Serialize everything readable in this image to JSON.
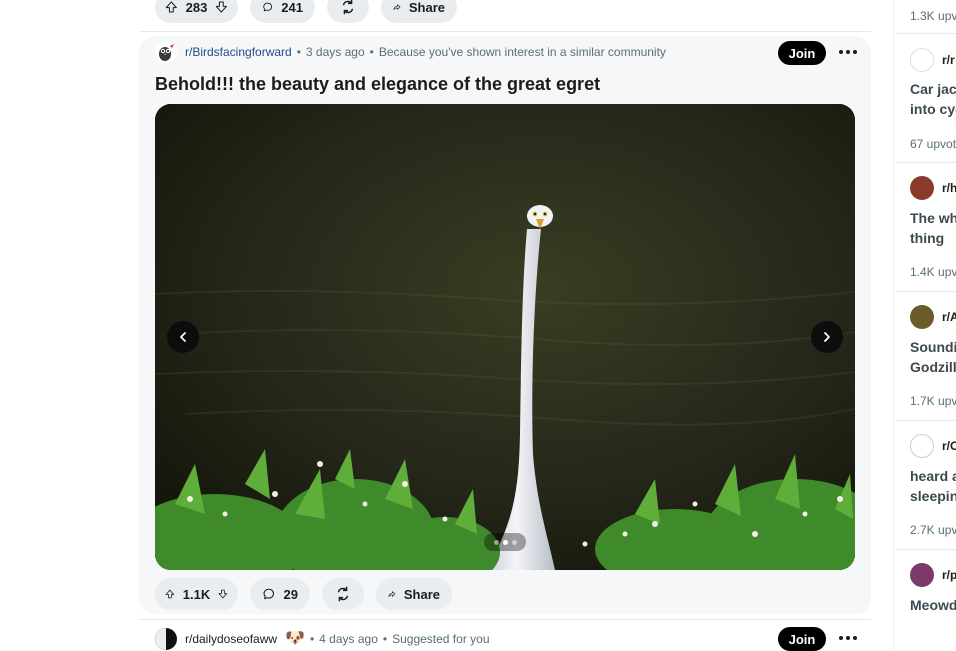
{
  "prev_post": {
    "upvotes": "283",
    "comments": "241",
    "share_label": "Share"
  },
  "post": {
    "subreddit": "r/Birdsfacingforward",
    "time": "3 days ago",
    "reason": "Because you've shown interest in a similar community",
    "join_label": "Join",
    "title": "Behold!!! the beauty and elegance of the great egret",
    "gallery": {
      "current": 2,
      "total": 3
    },
    "upvotes": "1.1K",
    "comments": "29",
    "share_label": "Share"
  },
  "next_post": {
    "subreddit": "r/dailydoseofaww",
    "time": "4 days ago",
    "reason": "Suggested for you",
    "join_label": "Join"
  },
  "sidebar": {
    "top_stat": "1.3K upv",
    "items": [
      {
        "sub": "r/r",
        "title": "Car jack\ninto cyc",
        "stat": "67 upvot"
      },
      {
        "sub": "r/h",
        "title": "The wh\nthing",
        "stat": "1.4K upv"
      },
      {
        "sub": "r/A",
        "title": "Soundi\nGodzill",
        "stat": "1.7K upv"
      },
      {
        "sub": "r/C",
        "title": "heard a\nsleepin",
        "stat": "2.7K upv"
      },
      {
        "sub": "r/p",
        "title": "Meowd",
        "stat": ""
      }
    ]
  },
  "colors": {
    "join_bg": "#000000",
    "pill_bg": "#e9edef",
    "subreddit_link": "#1d4e89"
  }
}
